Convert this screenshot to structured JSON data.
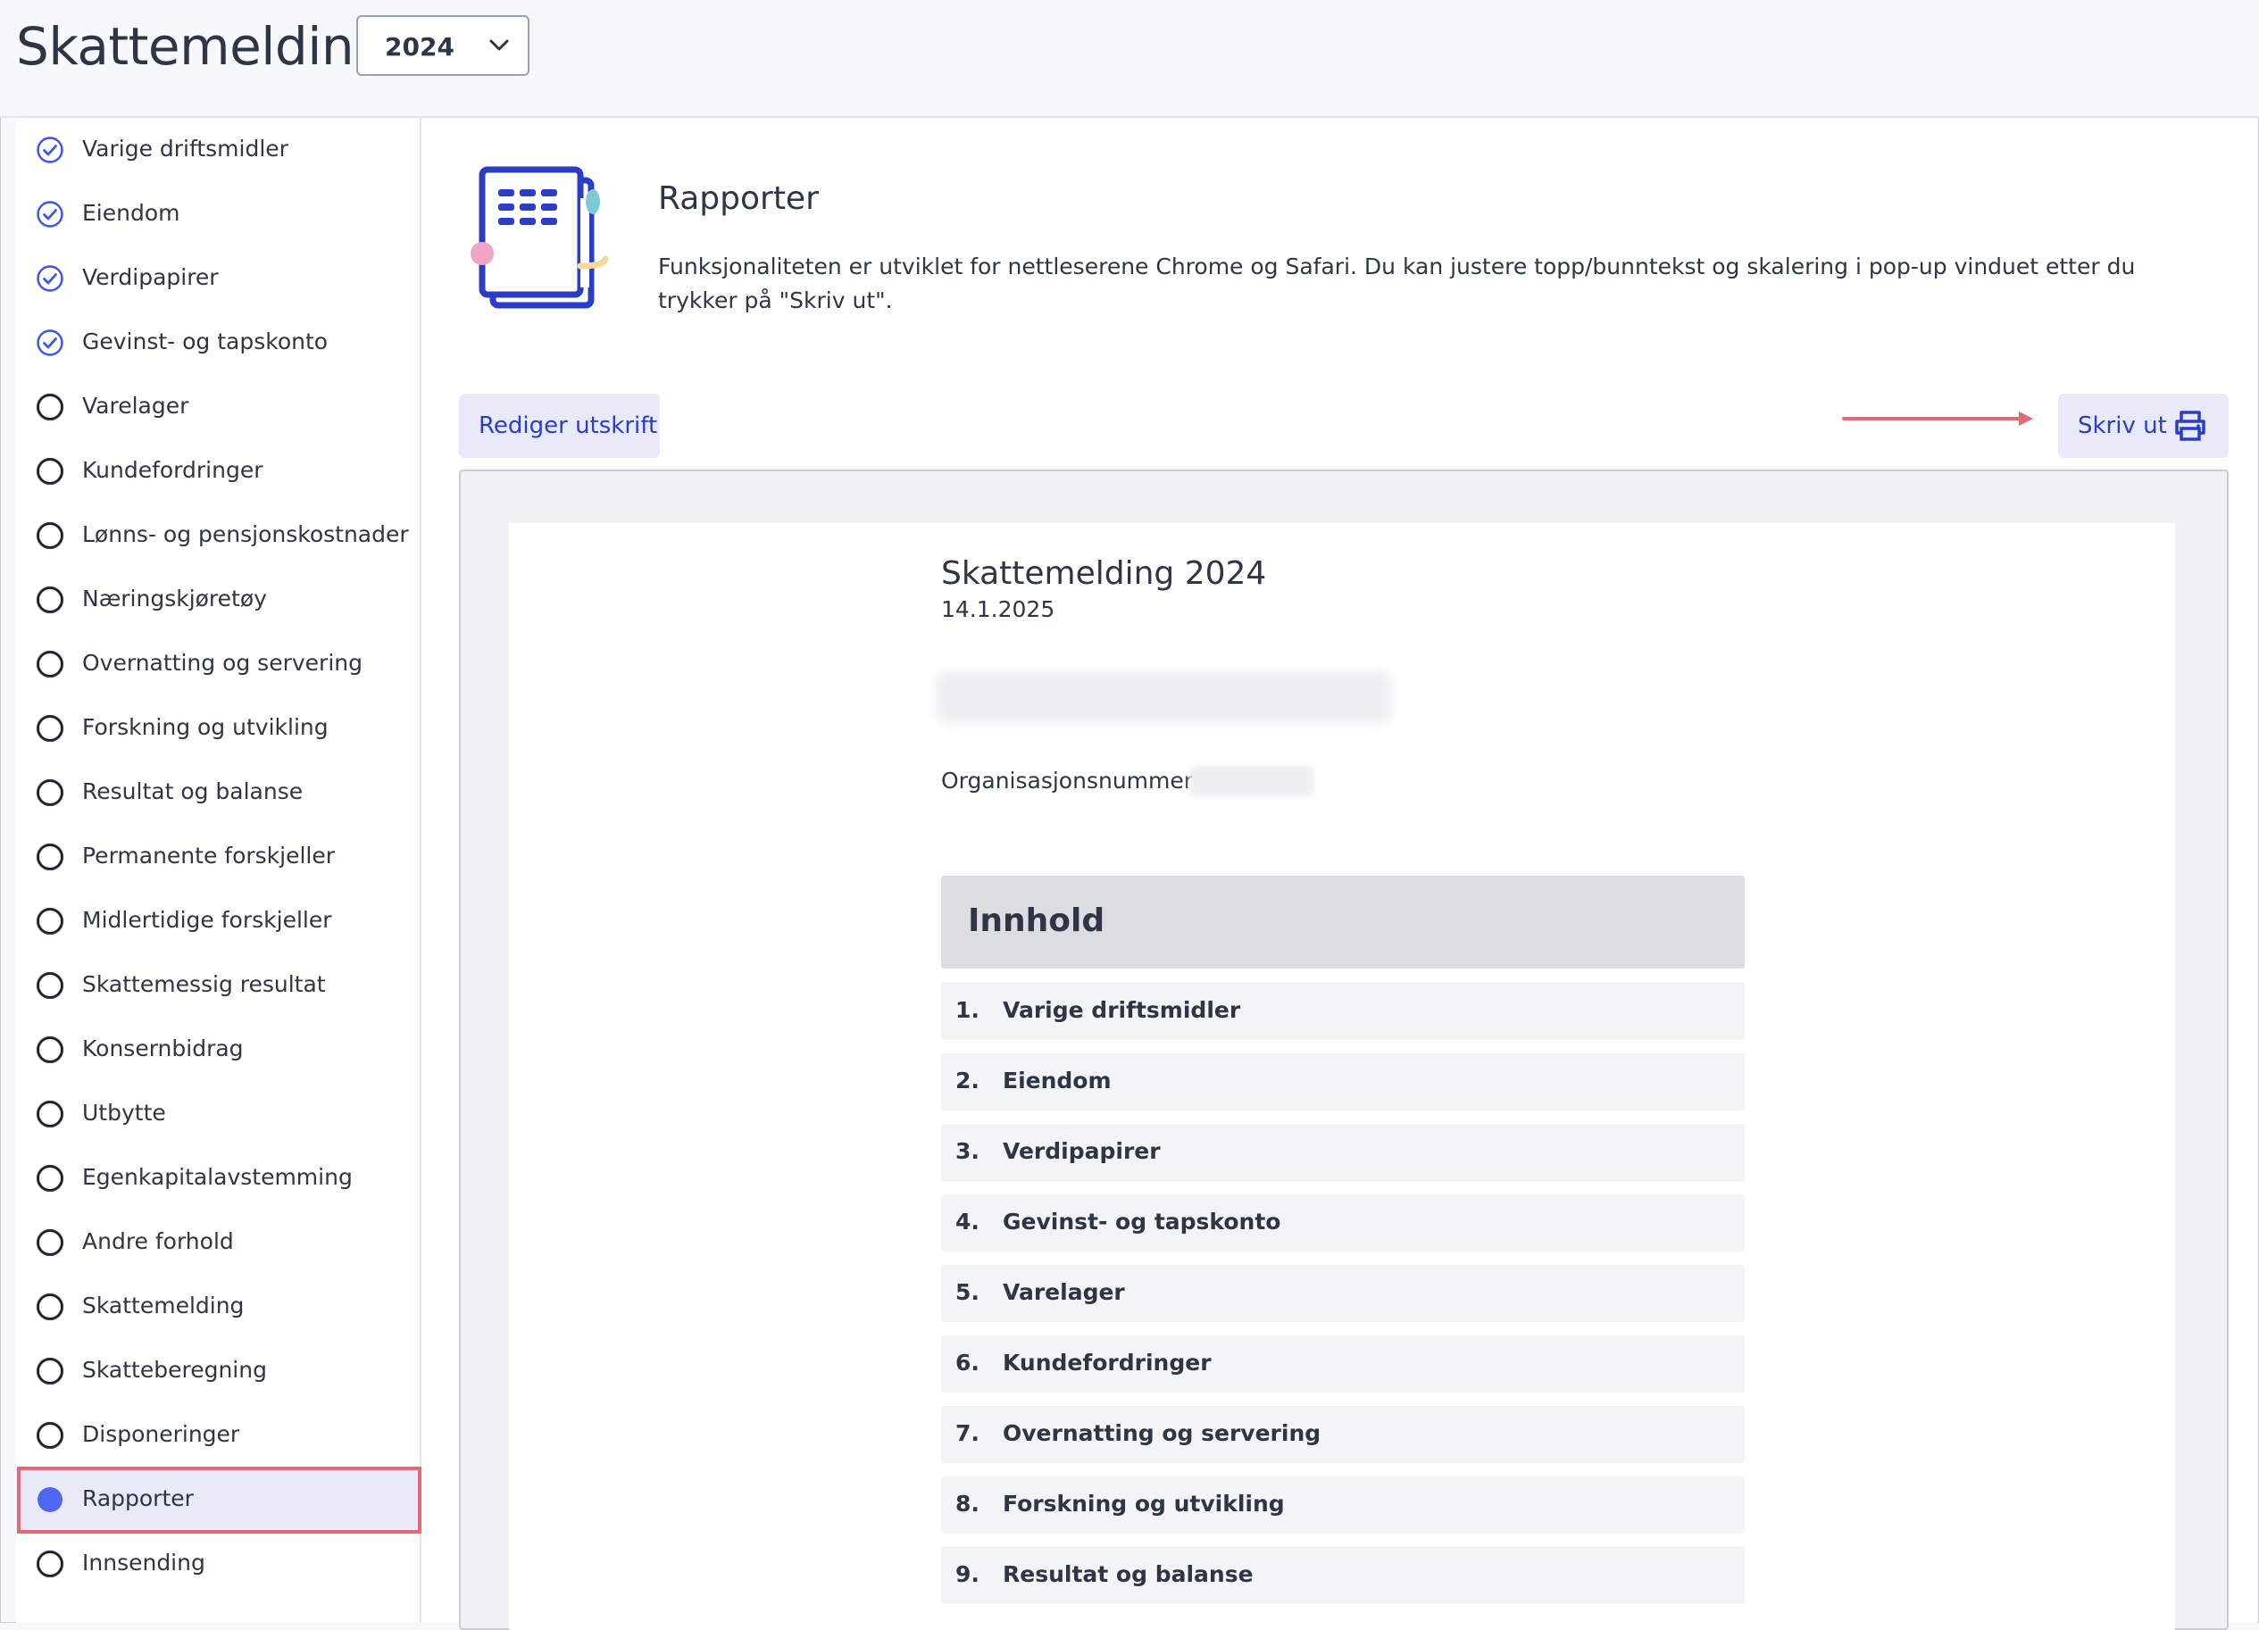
{
  "header": {
    "title": "Skattemelding",
    "year": "2024"
  },
  "sidebar": {
    "items": [
      {
        "label": "Varige driftsmidler",
        "state": "done"
      },
      {
        "label": "Eiendom",
        "state": "done"
      },
      {
        "label": "Verdipapirer",
        "state": "done"
      },
      {
        "label": "Gevinst- og tapskonto",
        "state": "done"
      },
      {
        "label": "Varelager",
        "state": "todo"
      },
      {
        "label": "Kundefordringer",
        "state": "todo"
      },
      {
        "label": "Lønns- og pensjonskostnader",
        "state": "todo"
      },
      {
        "label": "Næringskjøretøy",
        "state": "todo"
      },
      {
        "label": "Overnatting og servering",
        "state": "todo"
      },
      {
        "label": "Forskning og utvikling",
        "state": "todo"
      },
      {
        "label": "Resultat og balanse",
        "state": "todo"
      },
      {
        "label": "Permanente forskjeller",
        "state": "todo"
      },
      {
        "label": "Midlertidige forskjeller",
        "state": "todo"
      },
      {
        "label": "Skattemessig resultat",
        "state": "todo"
      },
      {
        "label": "Konsernbidrag",
        "state": "todo"
      },
      {
        "label": "Utbytte",
        "state": "todo"
      },
      {
        "label": "Egenkapitalavstemming",
        "state": "todo"
      },
      {
        "label": "Andre forhold",
        "state": "todo"
      },
      {
        "label": "Skattemelding",
        "state": "todo"
      },
      {
        "label": "Skatteberegning",
        "state": "todo"
      },
      {
        "label": "Disponeringer",
        "state": "todo"
      },
      {
        "label": "Rapporter",
        "state": "active"
      },
      {
        "label": "Innsending",
        "state": "todo"
      }
    ]
  },
  "main": {
    "title": "Rapporter",
    "description": "Funksjonaliteten er utviklet for nettleserene Chrome og Safari. Du kan justere topp/bunntekst og skalering i pop-up vinduet etter du trykker på \"Skriv ut\".",
    "edit_button": "Rediger utskrift",
    "print_button": "Skriv ut"
  },
  "document": {
    "title": "Skattemelding 2024",
    "date": "14.1.2025",
    "org_label": "Organisasjonsnummer:",
    "toc_title": "Innhold",
    "toc": [
      {
        "num": "1.",
        "label": "Varige driftsmidler"
      },
      {
        "num": "2.",
        "label": "Eiendom"
      },
      {
        "num": "3.",
        "label": "Verdipapirer"
      },
      {
        "num": "4.",
        "label": "Gevinst- og tapskonto"
      },
      {
        "num": "5.",
        "label": "Varelager"
      },
      {
        "num": "6.",
        "label": "Kundefordringer"
      },
      {
        "num": "7.",
        "label": "Overnatting og servering"
      },
      {
        "num": "8.",
        "label": "Forskning og utvikling"
      },
      {
        "num": "9.",
        "label": "Resultat og balanse"
      }
    ]
  },
  "colors": {
    "accent": "#2b3cc7",
    "active_dot": "#4f67f0",
    "highlight": "#e06b74",
    "check": "#3d56e6"
  },
  "icons": {
    "done": "check-circle-icon",
    "todo": "empty-circle-icon",
    "active": "filled-circle-icon",
    "print": "printer-icon",
    "dropdown": "chevron-down-icon"
  }
}
